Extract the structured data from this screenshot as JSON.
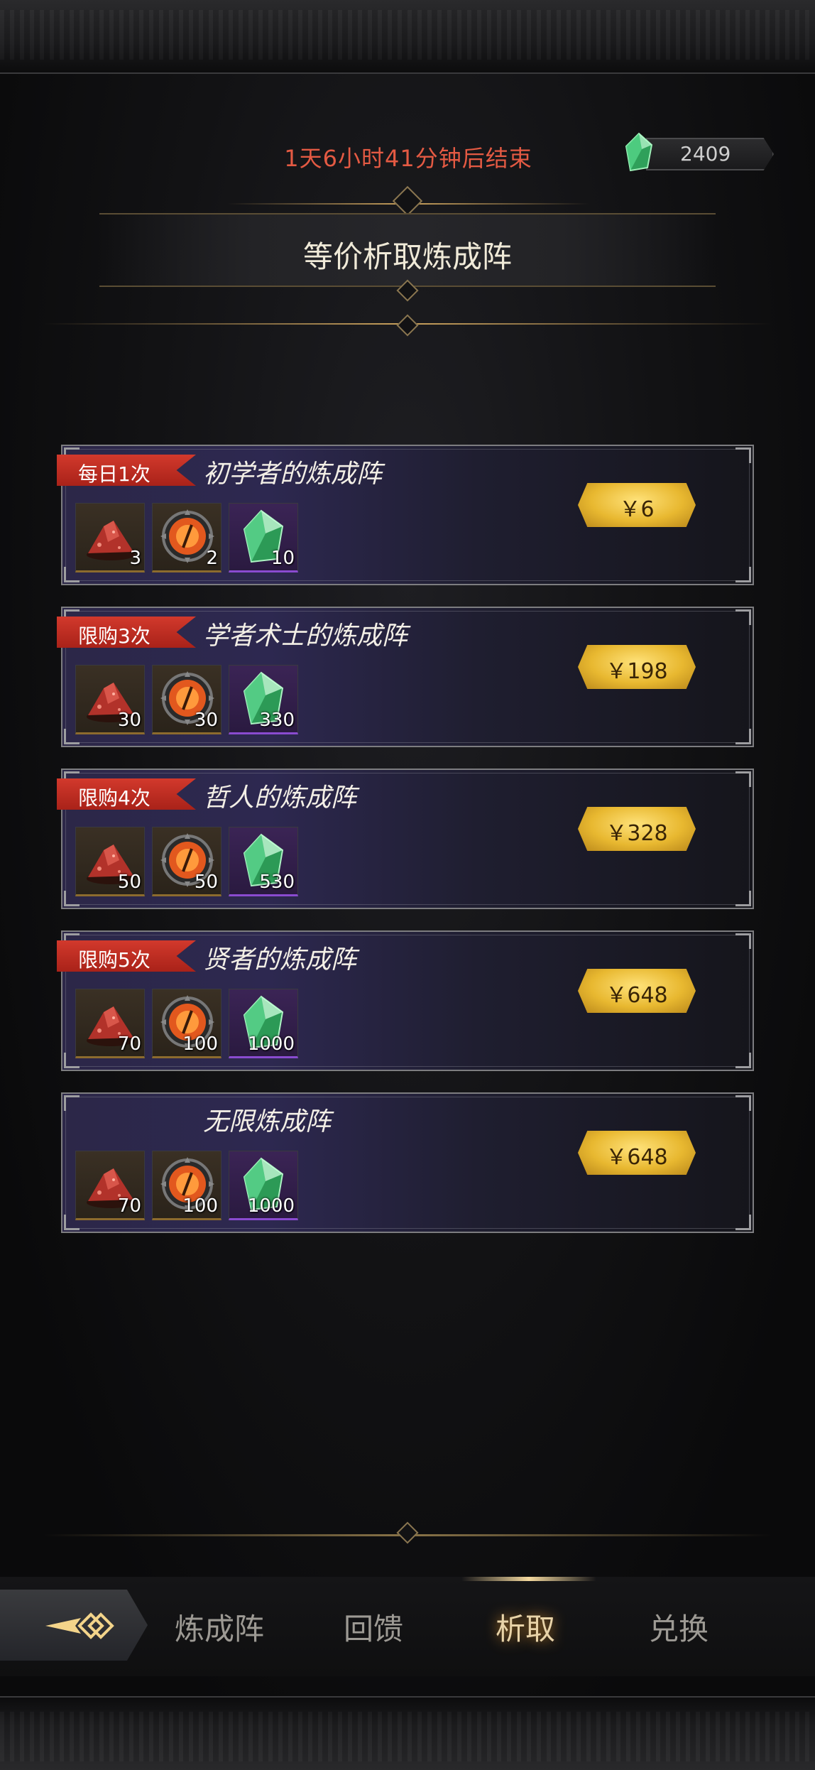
{
  "header": {
    "timer_text": "1天6小时41分钟后结束",
    "currency_amount": "2409",
    "currency_icon": "green-crystal-icon",
    "title": "等价析取炼成阵"
  },
  "colors": {
    "timer": "#e45a43",
    "tag_red": "#c7302a",
    "price_gold": "#e8b830",
    "card_purple": "#2c2748",
    "active_tab": "#e8d3a8"
  },
  "offers": [
    {
      "tag": "每日1次",
      "name": "初学者的炼成阵",
      "price": "￥6",
      "items": [
        {
          "icon": "red-ore-icon",
          "qty": "3"
        },
        {
          "icon": "fire-eye-icon",
          "qty": "2"
        },
        {
          "icon": "green-crystal-icon",
          "qty": "10"
        }
      ]
    },
    {
      "tag": "限购3次",
      "name": "学者术士的炼成阵",
      "price": "￥198",
      "items": [
        {
          "icon": "red-ore-icon",
          "qty": "30"
        },
        {
          "icon": "fire-eye-icon",
          "qty": "30"
        },
        {
          "icon": "green-crystal-icon",
          "qty": "330"
        }
      ]
    },
    {
      "tag": "限购4次",
      "name": "哲人的炼成阵",
      "price": "￥328",
      "items": [
        {
          "icon": "red-ore-icon",
          "qty": "50"
        },
        {
          "icon": "fire-eye-icon",
          "qty": "50"
        },
        {
          "icon": "green-crystal-icon",
          "qty": "530"
        }
      ]
    },
    {
      "tag": "限购5次",
      "name": "贤者的炼成阵",
      "price": "￥648",
      "items": [
        {
          "icon": "red-ore-icon",
          "qty": "70"
        },
        {
          "icon": "fire-eye-icon",
          "qty": "100"
        },
        {
          "icon": "green-crystal-icon",
          "qty": "1000"
        }
      ]
    },
    {
      "tag": "",
      "name": "无限炼成阵",
      "price": "￥648",
      "items": [
        {
          "icon": "red-ore-icon",
          "qty": "70"
        },
        {
          "icon": "fire-eye-icon",
          "qty": "100"
        },
        {
          "icon": "green-crystal-icon",
          "qty": "1000"
        }
      ]
    }
  ],
  "nav": {
    "back_icon": "back-arrow-icon",
    "tabs": [
      "炼成阵",
      "回馈",
      "析取",
      "兑换"
    ],
    "active_tab": "析取"
  }
}
